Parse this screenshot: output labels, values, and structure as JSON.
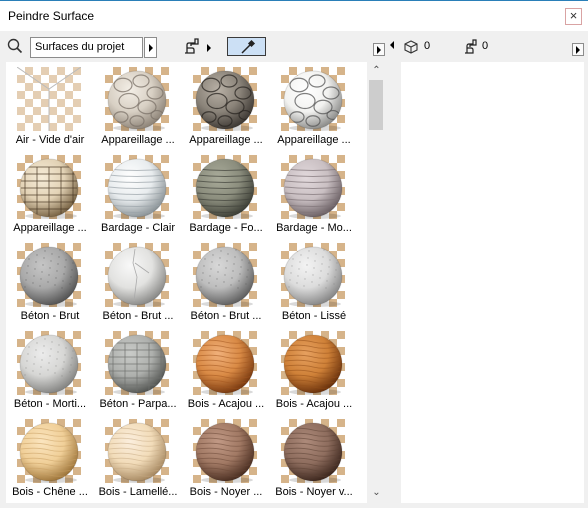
{
  "window": {
    "title": "Peindre Surface"
  },
  "toolbar": {
    "surface_filter": "Surfaces du projet"
  },
  "panel_stats": {
    "surfaces_count": "0",
    "painted_count": "0"
  },
  "surfaces": [
    {
      "label": "Air - Vide d'air",
      "style": "air"
    },
    {
      "label": "Appareillage ...",
      "style": "stone-light"
    },
    {
      "label": "Appareillage ...",
      "style": "stone-dark"
    },
    {
      "label": "Appareillage ...",
      "style": "stone-white"
    },
    {
      "label": "Appareillage ...",
      "style": "stone-beige"
    },
    {
      "label": "Bardage - Clair",
      "style": "siding-light"
    },
    {
      "label": "Bardage - Fo...",
      "style": "siding-dark"
    },
    {
      "label": "Bardage - Mo...",
      "style": "siding-mauve"
    },
    {
      "label": "Béton - Brut",
      "style": "concrete-mid"
    },
    {
      "label": "Béton - Brut ...",
      "style": "concrete-light"
    },
    {
      "label": "Béton - Brut ...",
      "style": "concrete-grey"
    },
    {
      "label": "Béton - Lissé",
      "style": "concrete-smooth"
    },
    {
      "label": "Béton - Morti...",
      "style": "concrete-mortar"
    },
    {
      "label": "Béton - Parpa...",
      "style": "concrete-block"
    },
    {
      "label": "Bois - Acajou ...",
      "style": "wood-acajou"
    },
    {
      "label": "Bois - Acajou ...",
      "style": "wood-acajou2"
    },
    {
      "label": "Bois - Chêne ...",
      "style": "wood-oak"
    },
    {
      "label": "Bois - Lamellé...",
      "style": "wood-lam"
    },
    {
      "label": "Bois - Noyer ...",
      "style": "wood-walnut"
    },
    {
      "label": "Bois - Noyer v...",
      "style": "wood-walnut2"
    }
  ],
  "colors": {
    "accent": "#2a7fb8",
    "selection": "#cce0f5"
  }
}
